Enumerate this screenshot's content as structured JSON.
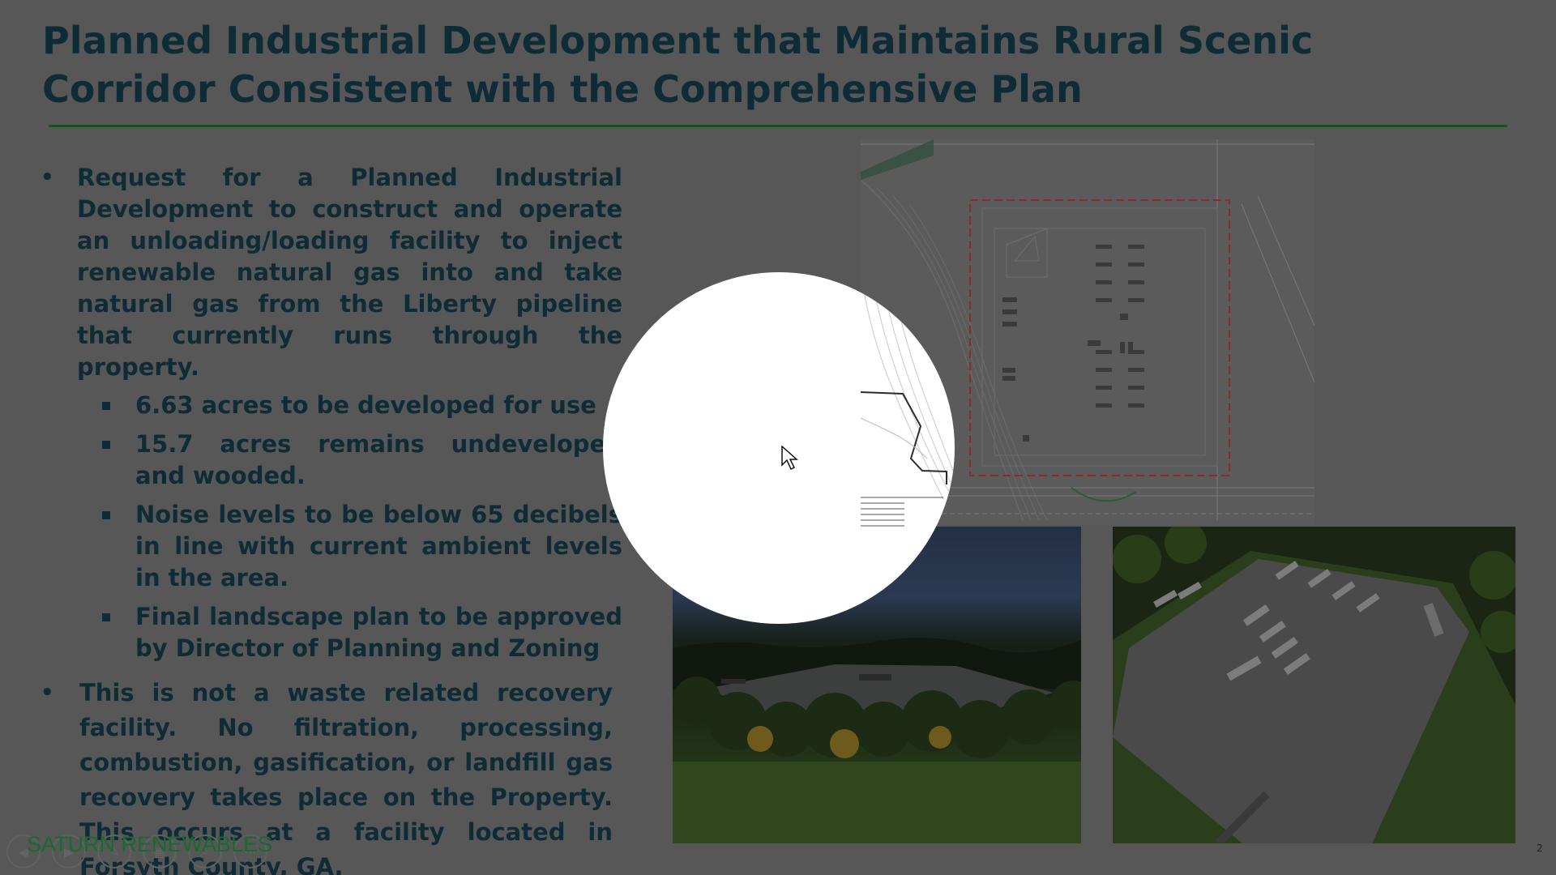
{
  "slide": {
    "title": "Planned Industrial Development that Maintains Rural Scenic Corridor Consistent with the Comprehensive Plan",
    "bullets": [
      {
        "text": "Request for a Planned Industrial Development to construct and operate an unloading/loading facility to inject renewable natural gas into and take natural gas from the Liberty pipeline that currently runs through the property.",
        "subbullets": [
          "6.63 acres to be developed for use",
          "15.7 acres remains undeveloped and wooded.",
          "Noise levels to be below 65 decibels in line with current ambient levels in the area.",
          "Final landscape plan to be approved by Director of Planning and Zoning"
        ]
      },
      {
        "text": "This is not a waste related recovery facility. No filtration, processing, combustion, gasification, or landfill gas recovery takes place on the Property. This occurs at a facility located in Forsyth County, GA.",
        "subbullets": []
      }
    ],
    "brand": "SATURN RENEWABLES",
    "page_number": "2"
  },
  "colors": {
    "dim_overlay_background": "#575757",
    "title_text": "#0e2b36",
    "rule_and_brand": "#196a2e",
    "spotlight": "#ffffff"
  },
  "icons": {
    "bullet": "bullet-dot-icon",
    "sub_bullet": "square-bullet-icon",
    "cursor": "mouse-pointer-icon",
    "nav": [
      "previous-icon",
      "next-icon",
      "pen-icon",
      "slides-icon",
      "zoom-icon",
      "more-icon"
    ]
  }
}
